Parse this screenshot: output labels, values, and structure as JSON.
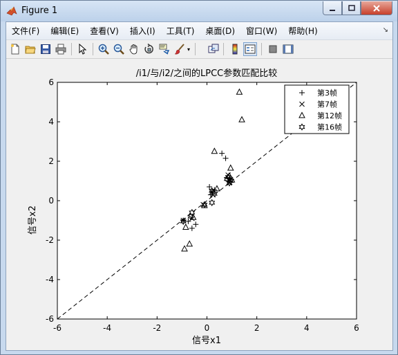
{
  "window": {
    "title": "Figure 1"
  },
  "menu": {
    "items": [
      "文件(F)",
      "编辑(E)",
      "查看(V)",
      "插入(I)",
      "工具(T)",
      "桌面(D)",
      "窗口(W)",
      "帮助(H)"
    ]
  },
  "toolbar": {
    "buttons": [
      "new-figure-icon",
      "open-file-icon",
      "save-icon",
      "print-icon",
      "pointer-icon",
      "zoom-in-icon",
      "zoom-out-icon",
      "pan-hand-icon",
      "rotate-3d-icon",
      "data-cursor-icon",
      "brush-icon",
      "link-plot-icon",
      "colorbar-icon",
      "legend-icon",
      "hide-plot-tools-icon",
      "show-plot-tools-icon"
    ]
  },
  "chart_data": {
    "type": "scatter",
    "title": "/i1/与/i2/之间的LPCC参数匹配比较",
    "xlabel": "信号x1",
    "ylabel": "信号x2",
    "xlim": [
      -6,
      6
    ],
    "ylim": [
      -6,
      6
    ],
    "xticks": [
      -6,
      -4,
      -2,
      0,
      2,
      4,
      6
    ],
    "yticks": [
      -6,
      -4,
      -2,
      0,
      2,
      4,
      6
    ],
    "grid": false,
    "legend_position": "top-right",
    "reference_line": {
      "style": "dashed",
      "from": [
        -6,
        -6
      ],
      "to": [
        6,
        6
      ]
    },
    "series": [
      {
        "name": "第3帧",
        "marker": "plus",
        "x": [
          0.6,
          0.75,
          0.1,
          0.2,
          0.3,
          0.15,
          -0.45,
          -0.6,
          -0.75,
          -0.95,
          0.85,
          0.9
        ],
        "y": [
          2.4,
          2.15,
          0.7,
          0.45,
          0.55,
          0.3,
          -1.2,
          -1.4,
          -1.05,
          -1.0,
          1.0,
          1.1
        ]
      },
      {
        "name": "第7帧",
        "marker": "x",
        "x": [
          0.85,
          0.95,
          0.2,
          0.25,
          -0.15,
          -0.6,
          -0.95,
          0.9
        ],
        "y": [
          1.3,
          1.05,
          0.45,
          0.3,
          -0.2,
          -0.9,
          -1.0,
          0.9
        ]
      },
      {
        "name": "第12帧",
        "marker": "triangle",
        "x": [
          1.3,
          1.4,
          0.3,
          0.95,
          -0.9,
          -0.7,
          -0.85,
          0.4,
          -0.1,
          -0.55,
          0.9,
          1.0
        ],
        "y": [
          5.5,
          4.1,
          2.5,
          1.65,
          -2.45,
          -2.2,
          -1.35,
          0.6,
          -0.25,
          -0.85,
          1.25,
          1.05
        ]
      },
      {
        "name": "第16帧",
        "marker": "hexagram",
        "x": [
          0.8,
          0.9,
          0.95,
          0.2,
          0.3,
          0.2,
          -0.1,
          -0.6,
          -0.65,
          -0.95,
          0.85
        ],
        "y": [
          1.1,
          0.9,
          1.0,
          0.5,
          0.35,
          -0.1,
          -0.2,
          -0.6,
          -0.8,
          -1.05,
          1.2
        ]
      }
    ]
  }
}
